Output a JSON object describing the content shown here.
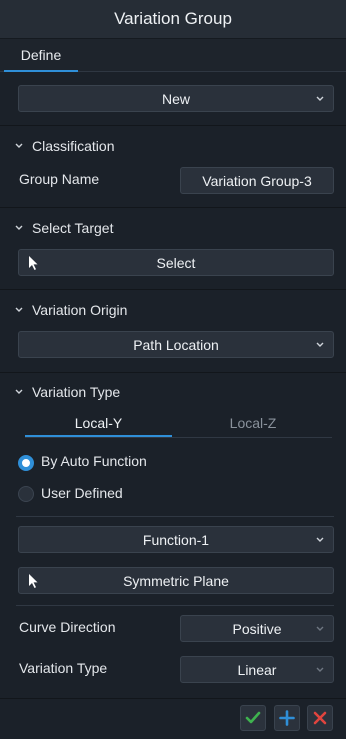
{
  "window": {
    "title": "Variation Group"
  },
  "tabs": [
    {
      "label": "Define",
      "active": true
    }
  ],
  "top": {
    "mode_value": "New"
  },
  "classification": {
    "header": "Classification",
    "group_name_label": "Group Name",
    "group_name_value": "Variation Group-3"
  },
  "select_target": {
    "header": "Select Target",
    "select_button": "Select"
  },
  "variation_origin": {
    "header": "Variation Origin",
    "value": "Path Location"
  },
  "variation_type": {
    "header": "Variation Type",
    "subtabs": [
      {
        "label": "Local-Y",
        "active": true
      },
      {
        "label": "Local-Z",
        "active": false
      }
    ],
    "radio_options": [
      {
        "label": "By Auto Function",
        "selected": true
      },
      {
        "label": "User Defined",
        "selected": false
      }
    ],
    "function_value": "Function-1",
    "symmetric_plane_button": "Symmetric Plane",
    "curve_direction_label": "Curve Direction",
    "curve_direction_value": "Positive",
    "variation_type_label": "Variation Type",
    "variation_type_value": "Linear"
  },
  "footer": {
    "icons": [
      "check-icon",
      "plus-icon",
      "close-icon"
    ],
    "colors": {
      "check": "#3fb34f",
      "plus": "#2f8fd8",
      "close": "#e0443e"
    }
  },
  "theme": {
    "accent": "#2f8fd8",
    "background": "#1c222b",
    "field": "#2a313b"
  }
}
